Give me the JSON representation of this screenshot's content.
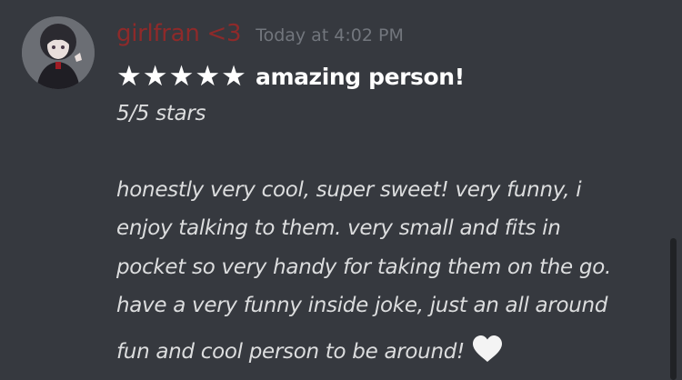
{
  "message": {
    "username": "girlfran <3",
    "timestamp": "Today at 4:02 PM",
    "stars": "★★★★★",
    "title": "amazing person!",
    "rating_text": "5/5 stars",
    "body_lines": [
      "honestly very cool, super sweet! very funny, i",
      "enjoy talking to them. very small and fits in",
      "pocket so very handy for taking them on the go.",
      "have a very funny inside joke, just an all around",
      "fun and cool person to be around!"
    ]
  },
  "rating": 5,
  "colors": {
    "background": "#36393f",
    "username": "#8e2a2a",
    "timestamp": "#72767d",
    "text": "#dcddde",
    "title": "#ffffff"
  },
  "icons": {
    "heart": "white-heart-icon",
    "star": "star-icon"
  }
}
